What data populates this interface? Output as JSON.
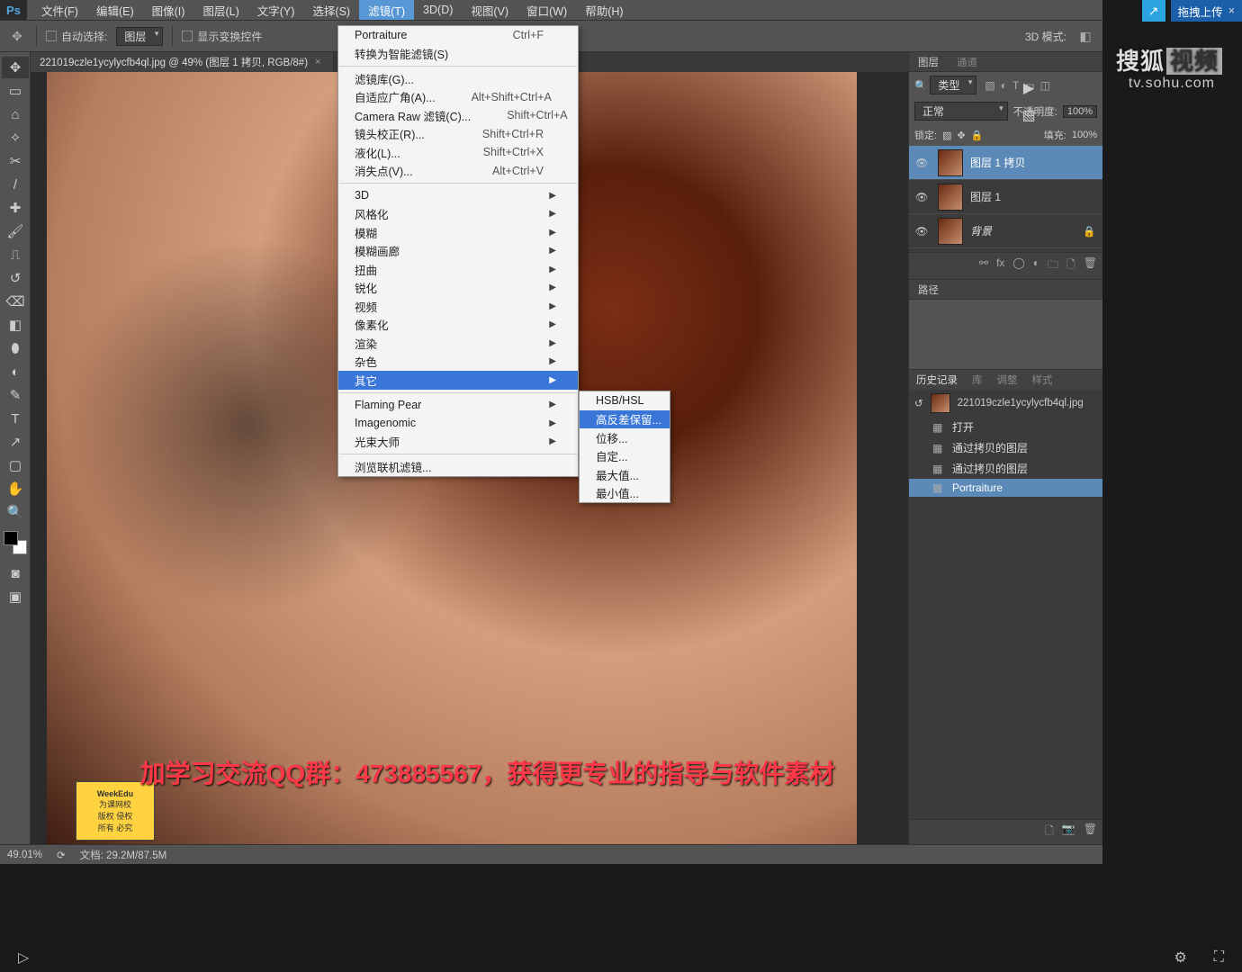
{
  "menubar": {
    "items": [
      "文件(F)",
      "编辑(E)",
      "图像(I)",
      "图层(L)",
      "文字(Y)",
      "选择(S)",
      "滤镜(T)",
      "3D(D)",
      "视图(V)",
      "窗口(W)",
      "帮助(H)"
    ],
    "active_index": 6,
    "logo": "Ps"
  },
  "topstrip": {
    "upload": "拖拽上传"
  },
  "optionsbar": {
    "autosel": "自动选择:",
    "layer_dd": "图层",
    "show_transform": "显示变换控件",
    "mode3d": "3D 模式:"
  },
  "doc_tab": {
    "title": "221019czle1ycylycfb4ql.jpg @ 49% (图层 1 拷贝, RGB/8#)"
  },
  "eyelabel": {
    "l1": "WeekEdu",
    "l2": "为课网校",
    "l3": "版权 侵权",
    "l4": "所有 必究"
  },
  "subtitle": "加学习交流QQ群：473885567，获得更专业的指导与软件素材",
  "statusbar": {
    "zoom": "49.01%",
    "doc": "文档: 29.2M/87.5M"
  },
  "filter_menu": {
    "items": [
      {
        "txt": "Portraiture",
        "sc": "Ctrl+F"
      },
      {
        "txt": "转换为智能滤镜(S)"
      },
      {
        "sep": true
      },
      {
        "txt": "滤镜库(G)..."
      },
      {
        "txt": "自适应广角(A)...",
        "sc": "Alt+Shift+Ctrl+A"
      },
      {
        "txt": "Camera Raw 滤镜(C)...",
        "sc": "Shift+Ctrl+A"
      },
      {
        "txt": "镜头校正(R)...",
        "sc": "Shift+Ctrl+R"
      },
      {
        "txt": "液化(L)...",
        "sc": "Shift+Ctrl+X"
      },
      {
        "txt": "消失点(V)...",
        "sc": "Alt+Ctrl+V"
      },
      {
        "sep": true
      },
      {
        "txt": "3D",
        "sub": true
      },
      {
        "txt": "风格化",
        "sub": true
      },
      {
        "txt": "模糊",
        "sub": true
      },
      {
        "txt": "模糊画廊",
        "sub": true
      },
      {
        "txt": "扭曲",
        "sub": true
      },
      {
        "txt": "锐化",
        "sub": true
      },
      {
        "txt": "视频",
        "sub": true
      },
      {
        "txt": "像素化",
        "sub": true
      },
      {
        "txt": "渲染",
        "sub": true
      },
      {
        "txt": "杂色",
        "sub": true
      },
      {
        "txt": "其它",
        "sub": true,
        "hl": true
      },
      {
        "sep": true
      },
      {
        "txt": "Flaming Pear",
        "sub": true
      },
      {
        "txt": "Imagenomic",
        "sub": true
      },
      {
        "txt": "光束大师",
        "sub": true
      },
      {
        "sep": true
      },
      {
        "txt": "浏览联机滤镜..."
      }
    ]
  },
  "other_menu": {
    "items": [
      {
        "txt": "HSB/HSL"
      },
      {
        "txt": "高反差保留...",
        "hl": true
      },
      {
        "txt": "位移..."
      },
      {
        "txt": "自定..."
      },
      {
        "txt": "最大值..."
      },
      {
        "txt": "最小值..."
      }
    ]
  },
  "panel_tabs": {
    "layers": "图层",
    "channels": "通道"
  },
  "layerctrl": {
    "type_label": "类型",
    "blend": "正常",
    "opacity_label": "不透明度:",
    "opacity_val": "100%",
    "lock_label": "锁定:",
    "fill_label": "填充:",
    "fill_val": "100%"
  },
  "layers": [
    {
      "name": "图层 1 拷贝",
      "sel": true
    },
    {
      "name": "图层 1"
    },
    {
      "name": "背景",
      "bg": true,
      "lock": true
    }
  ],
  "paths_tab": "路径",
  "history": {
    "tabs": [
      "历史记录",
      "库",
      "调整",
      "样式"
    ],
    "snapshot": "221019czle1ycylycfb4ql.jpg",
    "items": [
      {
        "txt": "打开"
      },
      {
        "txt": "通过拷贝的图层"
      },
      {
        "txt": "通过拷贝的图层"
      },
      {
        "txt": "Portraiture",
        "sel": true
      }
    ]
  },
  "sohu": {
    "brand": "搜狐",
    "vid": "视频",
    "url": "tv.sohu.com"
  }
}
